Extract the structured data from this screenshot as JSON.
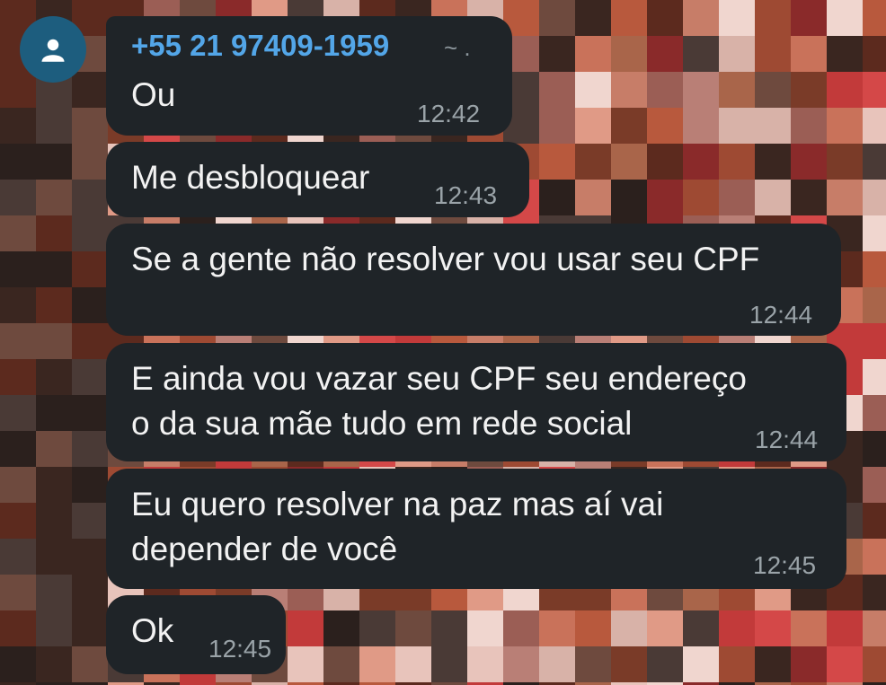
{
  "chat": {
    "sender": {
      "name": "+55 21 97409-1959",
      "alias": "~ ."
    },
    "avatar_icon": "person-icon",
    "messages": [
      {
        "text": "Ou",
        "time": "12:42"
      },
      {
        "text": "Me desbloquear",
        "time": "12:43"
      },
      {
        "text": "Se a gente não resolver vou usar seu CPF",
        "time": "12:44"
      },
      {
        "lines": [
          "E ainda vou vazar seu CPF seu endereço",
          "o da sua mãe tudo em rede social"
        ],
        "time": "12:44"
      },
      {
        "lines": [
          "Eu quero resolver na paz mas aí vai",
          "depender de você"
        ],
        "time": "12:45"
      },
      {
        "text": "Ok",
        "time": "12:45"
      }
    ]
  },
  "colors": {
    "bubble": "#1f2428",
    "sender_name": "#53a6e8",
    "avatar": "#1d5d7e",
    "timestamp": "#9aa3a8"
  }
}
